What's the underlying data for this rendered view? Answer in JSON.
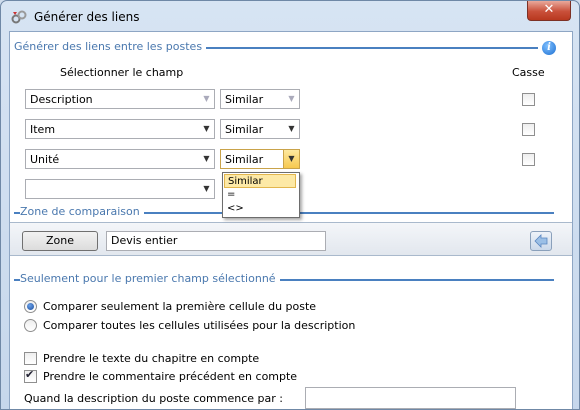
{
  "window": {
    "title": "Générer des liens",
    "close_label": "✕",
    "icon": "links-app-icon"
  },
  "links_section": {
    "title": "Générer des liens entre les postes",
    "header_field": "Sélectionner le champ",
    "header_case": "Casse",
    "rows": [
      {
        "field": "Description",
        "operator": "Similar",
        "case_checked": false
      },
      {
        "field": "Item",
        "operator": "Similar",
        "case_checked": false
      },
      {
        "field": "Unité",
        "operator": "Similar",
        "case_checked": false
      },
      {
        "field": "",
        "operator": "",
        "case_checked": false
      }
    ],
    "operator_options": [
      "Similar",
      "=",
      "<>"
    ],
    "operator_selected": "Similar"
  },
  "zone_section": {
    "title": "Zone de comparaison",
    "button_label": "Zone",
    "value": "Devis entier"
  },
  "first_field_section": {
    "title": "Seulement pour le premier champ sélectionné",
    "radio_options": [
      {
        "label": "Comparer seulement la première cellule du poste",
        "selected": true
      },
      {
        "label": "Comparer toutes les cellules utilisées pour la description",
        "selected": false
      }
    ],
    "checkboxes": [
      {
        "label": "Prendre le texte du chapitre en compte",
        "checked": false
      },
      {
        "label": "Prendre le commentaire précédent en compte",
        "checked": true
      }
    ],
    "starts_with_label": "Quand la description du poste commence par :",
    "starts_with_value": ""
  },
  "colors": {
    "section_title": "#4a78ae",
    "section_line": "#4a80c0",
    "close_button": "#c9503a",
    "dropdown_highlight": "#fde9a6"
  }
}
